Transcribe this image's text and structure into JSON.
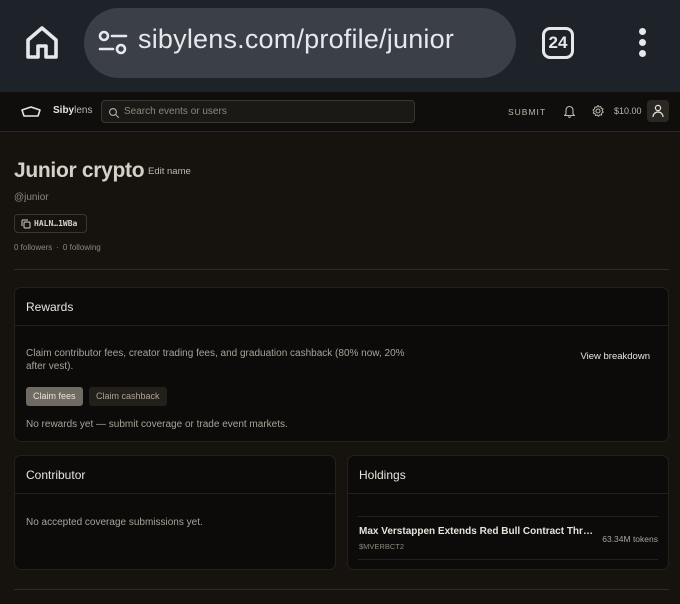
{
  "browser": {
    "url": "sibylens.com/profile/junior",
    "tab_count": "24"
  },
  "header": {
    "logo_text_a": "Siby",
    "logo_text_b": "lens",
    "search_placeholder": "Search events or users",
    "submit_label": "SUBMIT",
    "balance": "$10.00"
  },
  "profile": {
    "display_name": "Junior crypto",
    "edit_label": "Edit name",
    "handle": "@junior",
    "address": "HALN…1WBa",
    "followers": "0 followers",
    "separator": "·",
    "following": "0 following"
  },
  "rewards": {
    "title": "Rewards",
    "description": "Claim contributor fees, creator trading fees, and graduation cashback (80% now, 20% after vest).",
    "view_breakdown": "View breakdown",
    "claim_fees": "Claim fees",
    "claim_cashback": "Claim cashback",
    "empty_message": "No rewards yet — submit coverage or trade event markets."
  },
  "contributor": {
    "title": "Contributor",
    "empty_message": "No accepted coverage submissions yet."
  },
  "holdings": {
    "title": "Holdings",
    "items": [
      {
        "name": "Max Verstappen Extends Red Bull Contract Through ...",
        "ticker": "$MVERBCT2",
        "amount": "63.34M tokens"
      }
    ]
  }
}
